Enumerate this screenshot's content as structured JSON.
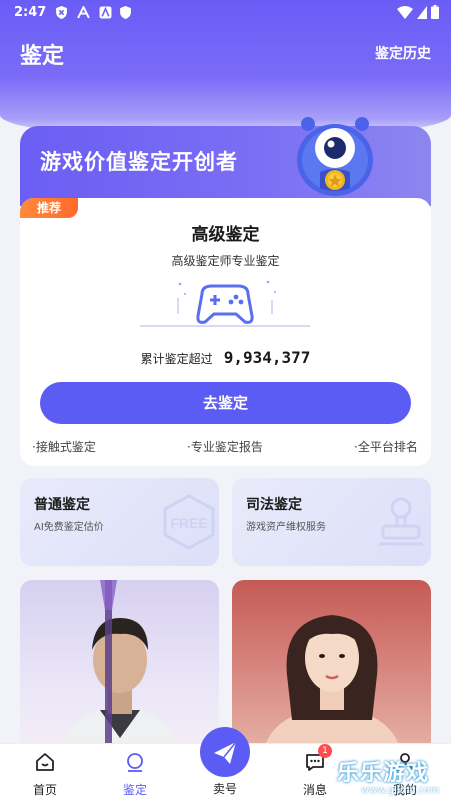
{
  "status_bar": {
    "time": "2:47"
  },
  "header": {
    "title": "鉴定",
    "history_link": "鉴定历史"
  },
  "hero": {
    "title": "游戏价值鉴定开创者"
  },
  "main_card": {
    "badge": "推荐",
    "title": "高级鉴定",
    "subtitle": "高级鉴定师专业鉴定",
    "stat_label": "累计鉴定超过",
    "stat_value": "9,934,377",
    "cta_label": "去鉴定",
    "features": [
      "·接触式鉴定",
      "·专业鉴定报告",
      "·全平台排名"
    ]
  },
  "services": [
    {
      "title": "普通鉴定",
      "desc": "AI免费鉴定估价",
      "icon_text": "FREE"
    },
    {
      "title": "司法鉴定",
      "desc": "游戏资产维权服务"
    }
  ],
  "bottom_nav": {
    "items": [
      {
        "label": "首页"
      },
      {
        "label": "鉴定"
      },
      {
        "label": "卖号"
      },
      {
        "label": "消息",
        "badge": "1"
      },
      {
        "label": "我的"
      }
    ]
  },
  "watermark": {
    "text": "乐乐游戏",
    "url": "www.gllmll.com"
  },
  "colors": {
    "accent": "#5b5cf3",
    "badge_orange": "#ff7a30",
    "notification_red": "#ff4d4f"
  }
}
